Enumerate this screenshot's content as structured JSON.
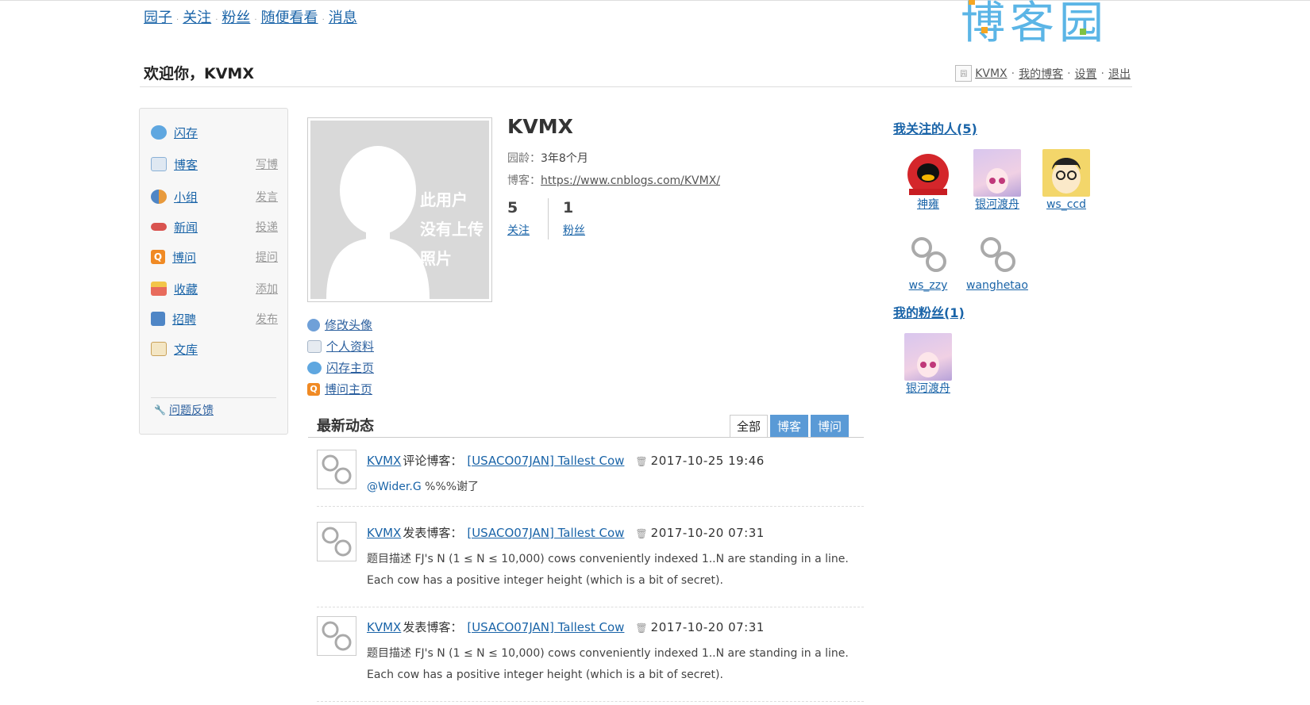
{
  "nav": {
    "items": [
      "园子",
      "关注",
      "粉丝",
      "随便看看",
      "消息"
    ],
    "logo_text": "博客园"
  },
  "header": {
    "welcome": "欢迎你，KVMX",
    "user_links": [
      "KVMX",
      "我的博客",
      "设置",
      "退出"
    ]
  },
  "sidebar": {
    "items": [
      {
        "label": "闪存",
        "action": "",
        "icon": "speech-bubble-icon",
        "color": "#5fa7e0"
      },
      {
        "label": "博客",
        "action": "写博",
        "icon": "pencil-note-icon",
        "color": "#8ab0d6"
      },
      {
        "label": "小组",
        "action": "发言",
        "icon": "people-icon",
        "color": "#e89a3c"
      },
      {
        "label": "新闻",
        "action": "投递",
        "icon": "news-icon",
        "color": "#d9534f"
      },
      {
        "label": "博问",
        "action": "提问",
        "icon": "q-icon",
        "color": "#f08a24"
      },
      {
        "label": "收藏",
        "action": "添加",
        "icon": "bookmark-folder-icon",
        "color": "#e86b5c"
      },
      {
        "label": "招聘",
        "action": "发布",
        "icon": "person-card-icon",
        "color": "#4f86c6"
      },
      {
        "label": "文库",
        "action": "",
        "icon": "book-icon",
        "color": "#c9a25a"
      }
    ],
    "feedback": "问题反馈"
  },
  "profile": {
    "name": "KVMX",
    "photo_text": [
      "此用户",
      "没有上传",
      "照片"
    ],
    "age_label": "园龄：",
    "age_value": "3年8个月",
    "blog_label": "博客：",
    "blog_url": "https://www.cnblogs.com/KVMX/",
    "following_count": "5",
    "following_label": "关注",
    "followers_count": "1",
    "followers_label": "粉丝",
    "links": [
      {
        "label": "修改头像",
        "icon": "gear-icon",
        "color": "#6fa0d8"
      },
      {
        "label": "个人资料",
        "icon": "id-card-icon",
        "color": "#a7b7c9"
      },
      {
        "label": "闪存主页",
        "icon": "speech-bubble-icon",
        "color": "#5fa7e0"
      },
      {
        "label": "博问主页",
        "icon": "q-icon",
        "color": "#f08a24"
      }
    ]
  },
  "activity": {
    "title": "最新动态",
    "tabs": [
      "全部",
      "博客",
      "博问"
    ],
    "entries": [
      {
        "user": "KVMX",
        "verb": "评论博客：",
        "post": "[USACO07JAN] Tallest Cow",
        "time": "2017-10-25 19:46",
        "mention": "@Wider.G",
        "body": " %%%谢了"
      },
      {
        "user": "KVMX",
        "verb": "发表博客：",
        "post": "[USACO07JAN] Tallest Cow",
        "time": "2017-10-20 07:31",
        "mention": "",
        "body": "题目描述 FJ's N (1 ≤ N ≤ 10,000) cows conveniently indexed 1..N are standing in a line. Each cow has a positive integer height (which is a bit of secret)."
      },
      {
        "user": "KVMX",
        "verb": "发表博客：",
        "post": "[USACO07JAN] Tallest Cow",
        "time": "2017-10-20 07:31",
        "mention": "",
        "body": "题目描述 FJ's N (1 ≤ N ≤ 10,000) cows conveniently indexed 1..N are standing in a line. Each cow has a positive integer height (which is a bit of secret)."
      }
    ]
  },
  "right": {
    "following_title": "我关注的人(5)",
    "following": [
      "神雍",
      "银河渡舟",
      "ws_ccd",
      "ws_zzy",
      "wanghetao"
    ],
    "followers_title": "我的粉丝(1)",
    "followers": [
      "银河渡舟"
    ]
  }
}
